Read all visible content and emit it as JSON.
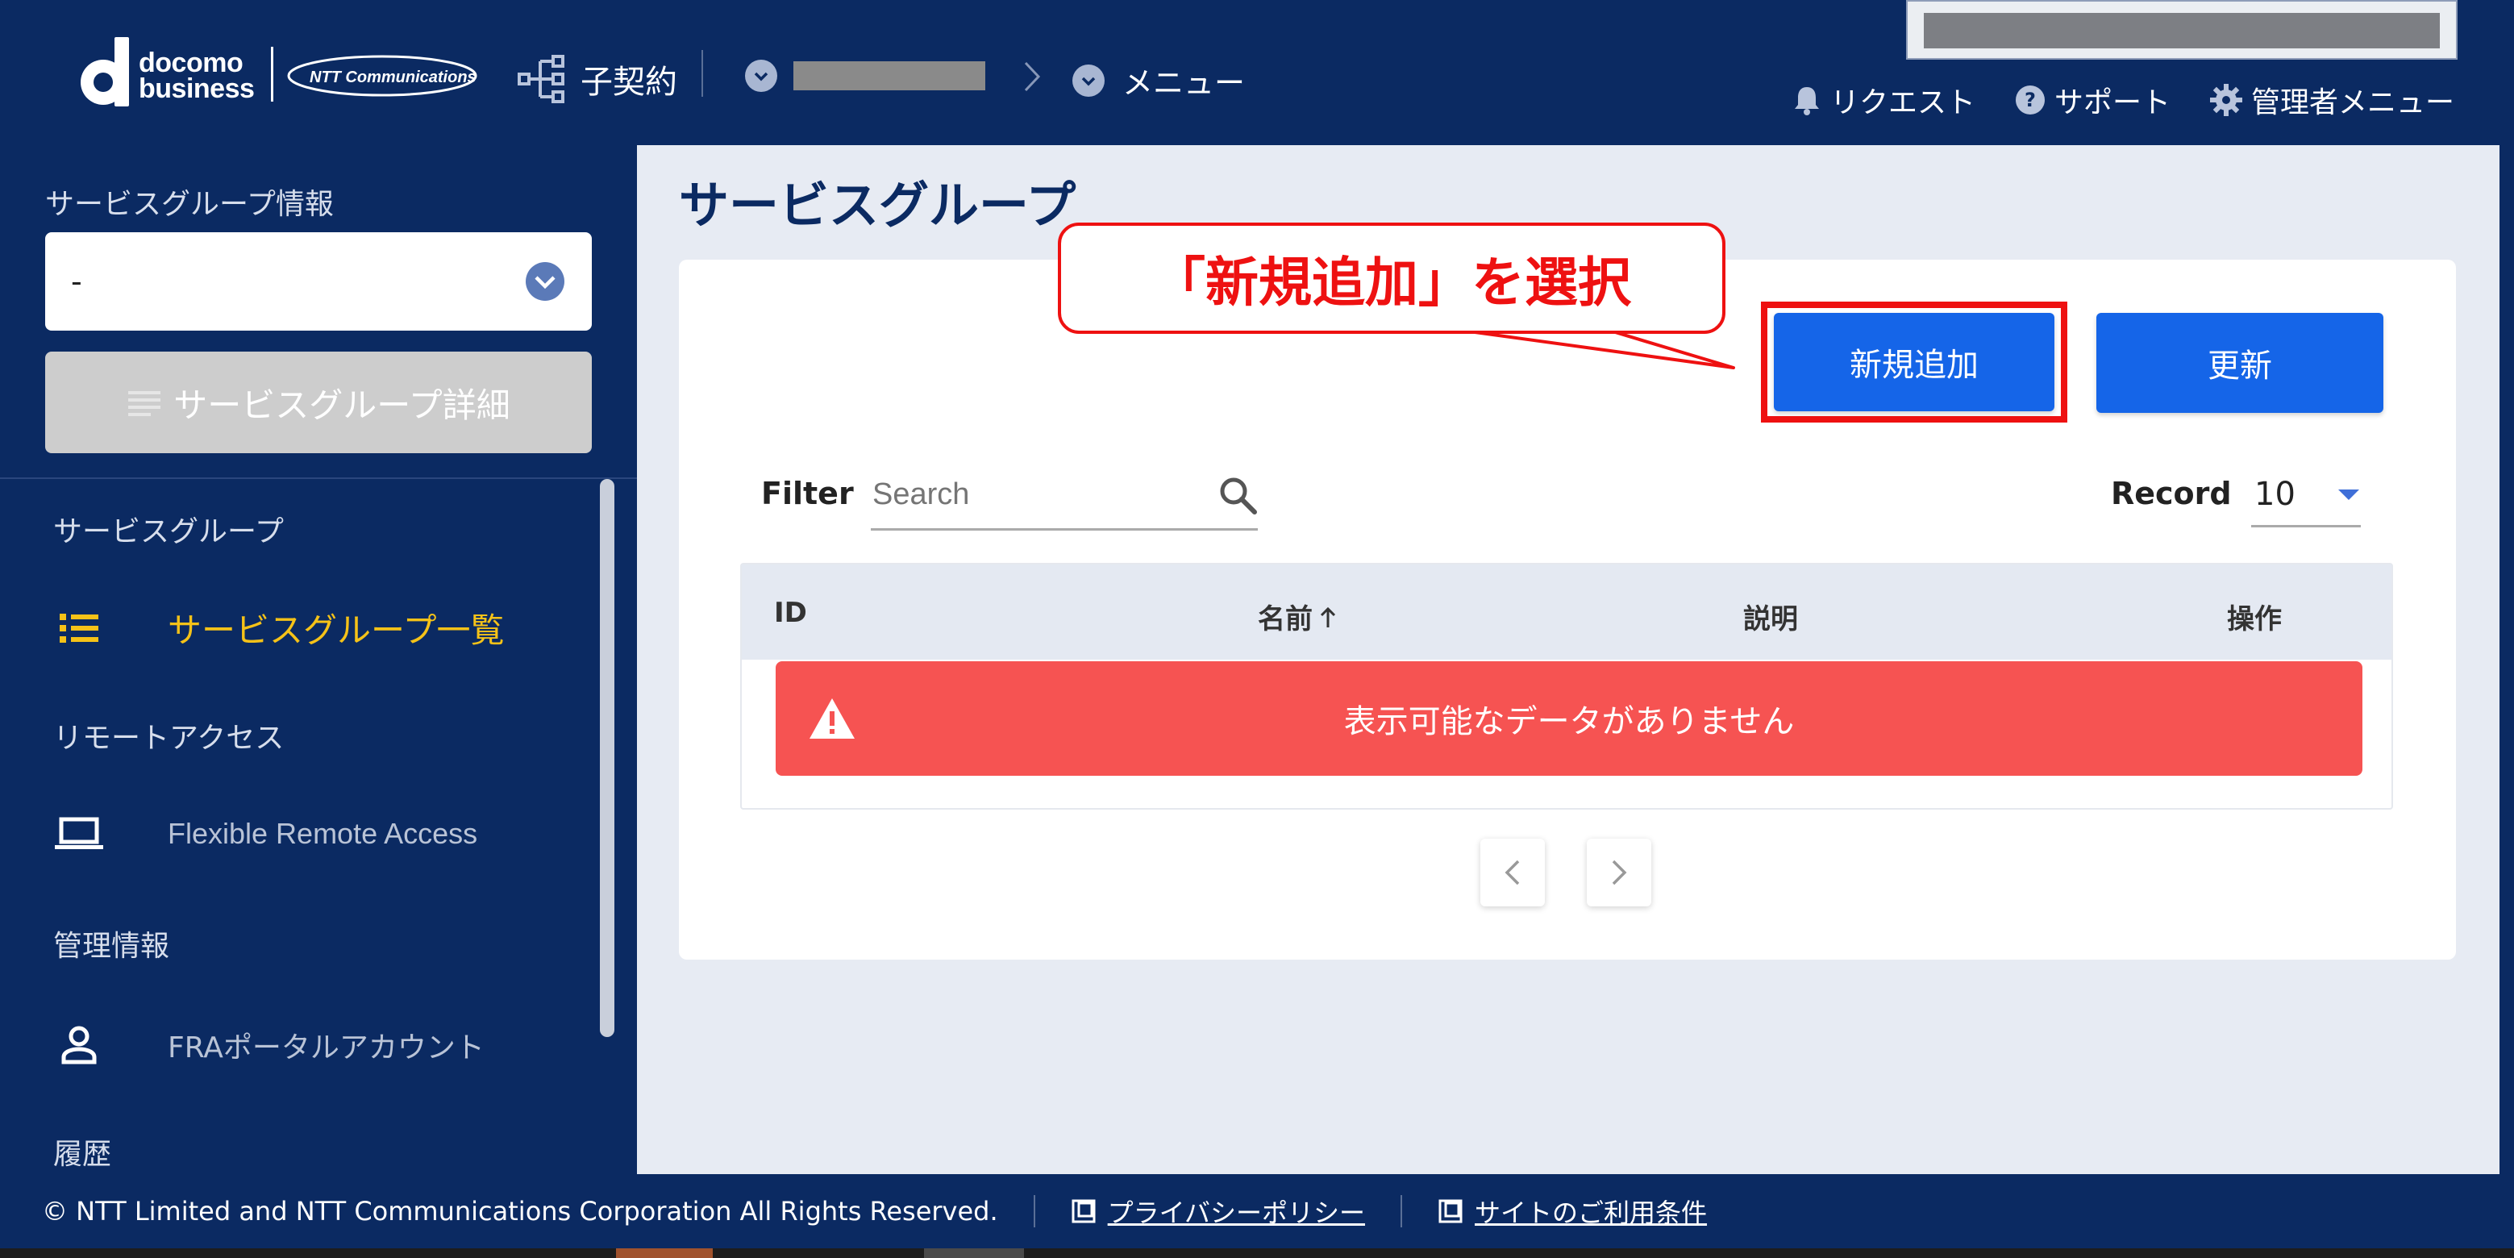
{
  "header": {
    "logo_line1": "docomo",
    "logo_line2": "business",
    "ntt_logo": "NTT Communications",
    "contract_label": "子契約",
    "crumb_menu": "メニュー",
    "links": {
      "request": "リクエスト",
      "support": "サポート",
      "admin_menu": "管理者メニュー"
    }
  },
  "sidebar": {
    "group_info_label": "サービスグループ情報",
    "group_select_value": "-",
    "group_detail_button": "サービスグループ詳細",
    "sections": {
      "service_group": "サービスグループ",
      "remote_access": "リモートアクセス",
      "management": "管理情報",
      "history": "履歴"
    },
    "items": {
      "service_group_list": "サービスグループ一覧",
      "flexible_remote_access": "Flexible Remote Access",
      "fra_portal_account": "FRAポータルアカウント"
    }
  },
  "main": {
    "page_title": "サービスグループ",
    "add_button": "新規追加",
    "refresh_button": "更新",
    "filter_label": "Filter",
    "search_placeholder": "Search",
    "record_label": "Record",
    "record_value": "10",
    "table": {
      "columns": {
        "id": "ID",
        "name": "名前",
        "description": "説明",
        "actions": "操作"
      },
      "empty_message": "表示可能なデータがありません"
    }
  },
  "annotation": {
    "callout_text": "「新規追加」を選択"
  },
  "footer": {
    "copyright": "© NTT Limited and NTT Communications Corporation All Rights Reserved.",
    "privacy_policy": "プライバシーポリシー",
    "terms_of_use": "サイトのご利用条件"
  },
  "colors": {
    "navy": "#0b2a62",
    "accent_blue": "#1565e8",
    "active_yellow": "#f5c218",
    "alert_red": "#f65352",
    "callout_red": "#ee1111"
  }
}
